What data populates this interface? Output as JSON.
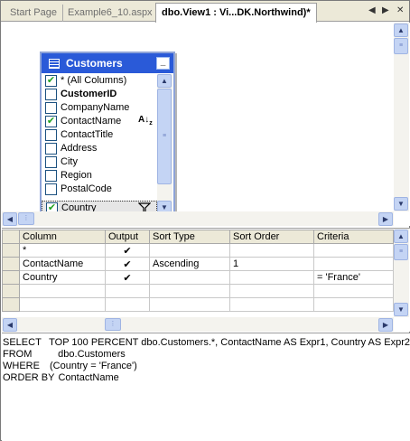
{
  "tabs": [
    {
      "label": "Start Page",
      "active": false
    },
    {
      "label": "Example6_10.aspx",
      "active": false
    },
    {
      "label": "dbo.View1 : Vi...DK.Northwind)*",
      "active": true
    }
  ],
  "tab_controls": {
    "prev": "◀",
    "next": "▶",
    "close": "✕"
  },
  "table": {
    "title": "Customers",
    "columns": [
      {
        "name": "* (All Columns)",
        "checked": true,
        "bold": false,
        "icon": ""
      },
      {
        "name": "CustomerID",
        "checked": false,
        "bold": true,
        "icon": ""
      },
      {
        "name": "CompanyName",
        "checked": false,
        "bold": false,
        "icon": ""
      },
      {
        "name": "ContactName",
        "checked": true,
        "bold": false,
        "icon": "sort-ascending-icon"
      },
      {
        "name": "ContactTitle",
        "checked": false,
        "bold": false,
        "icon": ""
      },
      {
        "name": "Address",
        "checked": false,
        "bold": false,
        "icon": ""
      },
      {
        "name": "City",
        "checked": false,
        "bold": false,
        "icon": ""
      },
      {
        "name": "Region",
        "checked": false,
        "bold": false,
        "icon": ""
      },
      {
        "name": "PostalCode",
        "checked": false,
        "bold": false,
        "icon": ""
      },
      {
        "name": "Country",
        "checked": true,
        "bold": false,
        "icon": "filter-icon"
      }
    ]
  },
  "grid": {
    "headers": [
      "Column",
      "Output",
      "Sort Type",
      "Sort Order",
      "Criteria"
    ],
    "rows": [
      {
        "column": "*",
        "output": true,
        "sort_type": "",
        "sort_order": "",
        "criteria": ""
      },
      {
        "column": "ContactName",
        "output": true,
        "sort_type": "Ascending",
        "sort_order": "1",
        "criteria": ""
      },
      {
        "column": "Country",
        "output": true,
        "sort_type": "",
        "sort_order": "",
        "criteria": "= 'France'"
      }
    ]
  },
  "sql": [
    {
      "keyword": "SELECT",
      "text": "TOP 100 PERCENT dbo.Customers.*, ContactName AS Expr1, Country AS Expr2"
    },
    {
      "keyword": "FROM",
      "text": "   dbo.Customers"
    },
    {
      "keyword": "WHERE",
      "text": "(Country = 'France')"
    },
    {
      "keyword": "ORDER BY",
      "text": "ContactName"
    }
  ],
  "colors": {
    "title_bar": "#2a5ad8",
    "chrome": "#ece9d8",
    "scroll": "#c4d4f4"
  }
}
